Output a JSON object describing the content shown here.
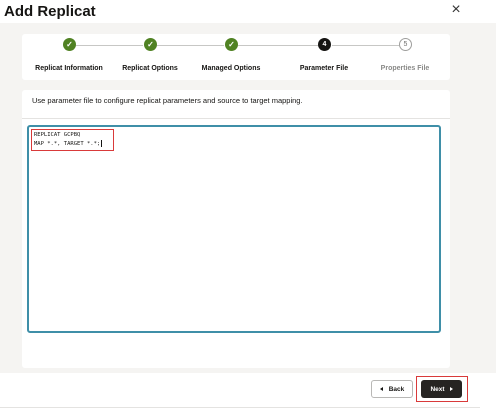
{
  "dialog": {
    "title": "Add Replicat",
    "close_icon": "×"
  },
  "wizard": {
    "steps": [
      {
        "label": "Replicat Information",
        "state": "done",
        "marker": "✓"
      },
      {
        "label": "Replicat Options",
        "state": "done",
        "marker": "✓"
      },
      {
        "label": "Managed Options",
        "state": "done",
        "marker": "✓"
      },
      {
        "label": "Parameter File",
        "state": "current",
        "marker": "4"
      },
      {
        "label": "Properties File",
        "state": "todo",
        "marker": "5"
      }
    ]
  },
  "content": {
    "instruction": "Use parameter file to configure replicat parameters and source to target mapping.",
    "parameter_lines": [
      "REPLICAT GCPBQ",
      "MAP *.*, TARGET *.*;"
    ]
  },
  "footer": {
    "back_label": "Back",
    "next_label": "Next"
  },
  "colors": {
    "done": "#508223",
    "current": "#161513",
    "editor_border": "#3f8fa8",
    "highlight": "#d93a3a",
    "next_button": "#262422"
  }
}
